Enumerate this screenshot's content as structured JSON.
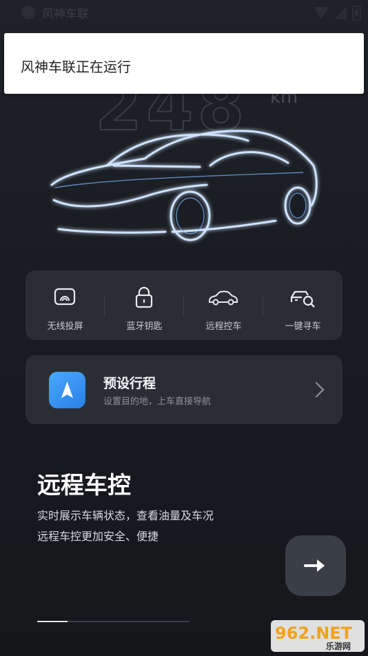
{
  "status_bar": {
    "app_title": "风神车联"
  },
  "notification": {
    "text": "风神车联正在运行"
  },
  "hero": {
    "range_value": "248",
    "range_unit": "km"
  },
  "quick_actions": [
    {
      "label": "无线投屏",
      "icon": "cast-screen-icon"
    },
    {
      "label": "蓝牙钥匙",
      "icon": "lock-icon"
    },
    {
      "label": "远程控车",
      "icon": "car-icon"
    },
    {
      "label": "一键寻车",
      "icon": "find-car-icon"
    }
  ],
  "trip": {
    "title": "预设行程",
    "subtitle": "设置目的地，上车直接导航",
    "icon": "navigation-arrow-icon"
  },
  "feature": {
    "title": "远程车控",
    "line1": "实时展示车辆状态，查看油量及车况",
    "line2": "远程车控更加安全、便捷"
  },
  "pager": {
    "progress": 0.2
  },
  "watermark": {
    "brand": "962.NET",
    "sub": "乐游网"
  },
  "colors": {
    "accent_blue": "#3d94f5",
    "card_bg": "#2a2e34",
    "background": "#1b1e23"
  }
}
